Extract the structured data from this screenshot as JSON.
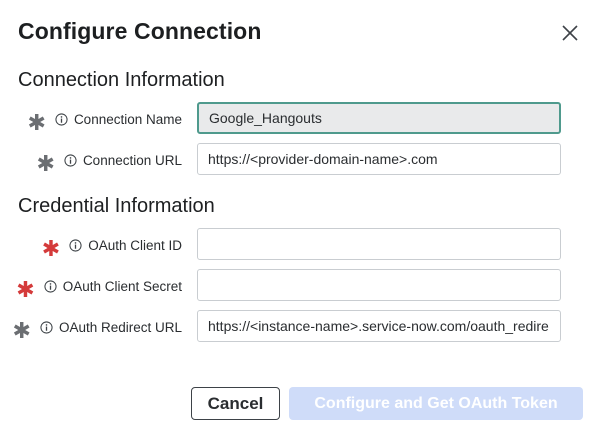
{
  "dialog": {
    "title": "Configure Connection",
    "close_icon": "close-icon"
  },
  "sections": {
    "connection": "Connection Information",
    "credential": "Credential Information"
  },
  "fields": {
    "connection_name": {
      "label": "Connection Name",
      "value": "Google_Hangouts",
      "required_color": "#6b6e72"
    },
    "connection_url": {
      "label": "Connection URL",
      "value": "https://<provider-domain-name>.com",
      "required_color": "#6b6e72"
    },
    "client_id": {
      "label": "OAuth Client ID",
      "value": "",
      "required_color": "#d43a3a"
    },
    "client_secret": {
      "label": "OAuth Client Secret",
      "value": "",
      "required_color": "#d43a3a"
    },
    "redirect_url": {
      "label": "OAuth Redirect URL",
      "value": "https://<instance-name>.service-now.com/oauth_redire",
      "required_color": "#6b6e72"
    }
  },
  "required_mark": "✱",
  "buttons": {
    "cancel": "Cancel",
    "primary": "Configure and Get OAuth Token"
  },
  "colors": {
    "focus_border": "#4f9a8d",
    "primary_disabled": "#cfdcf9",
    "required_red": "#d43a3a"
  }
}
